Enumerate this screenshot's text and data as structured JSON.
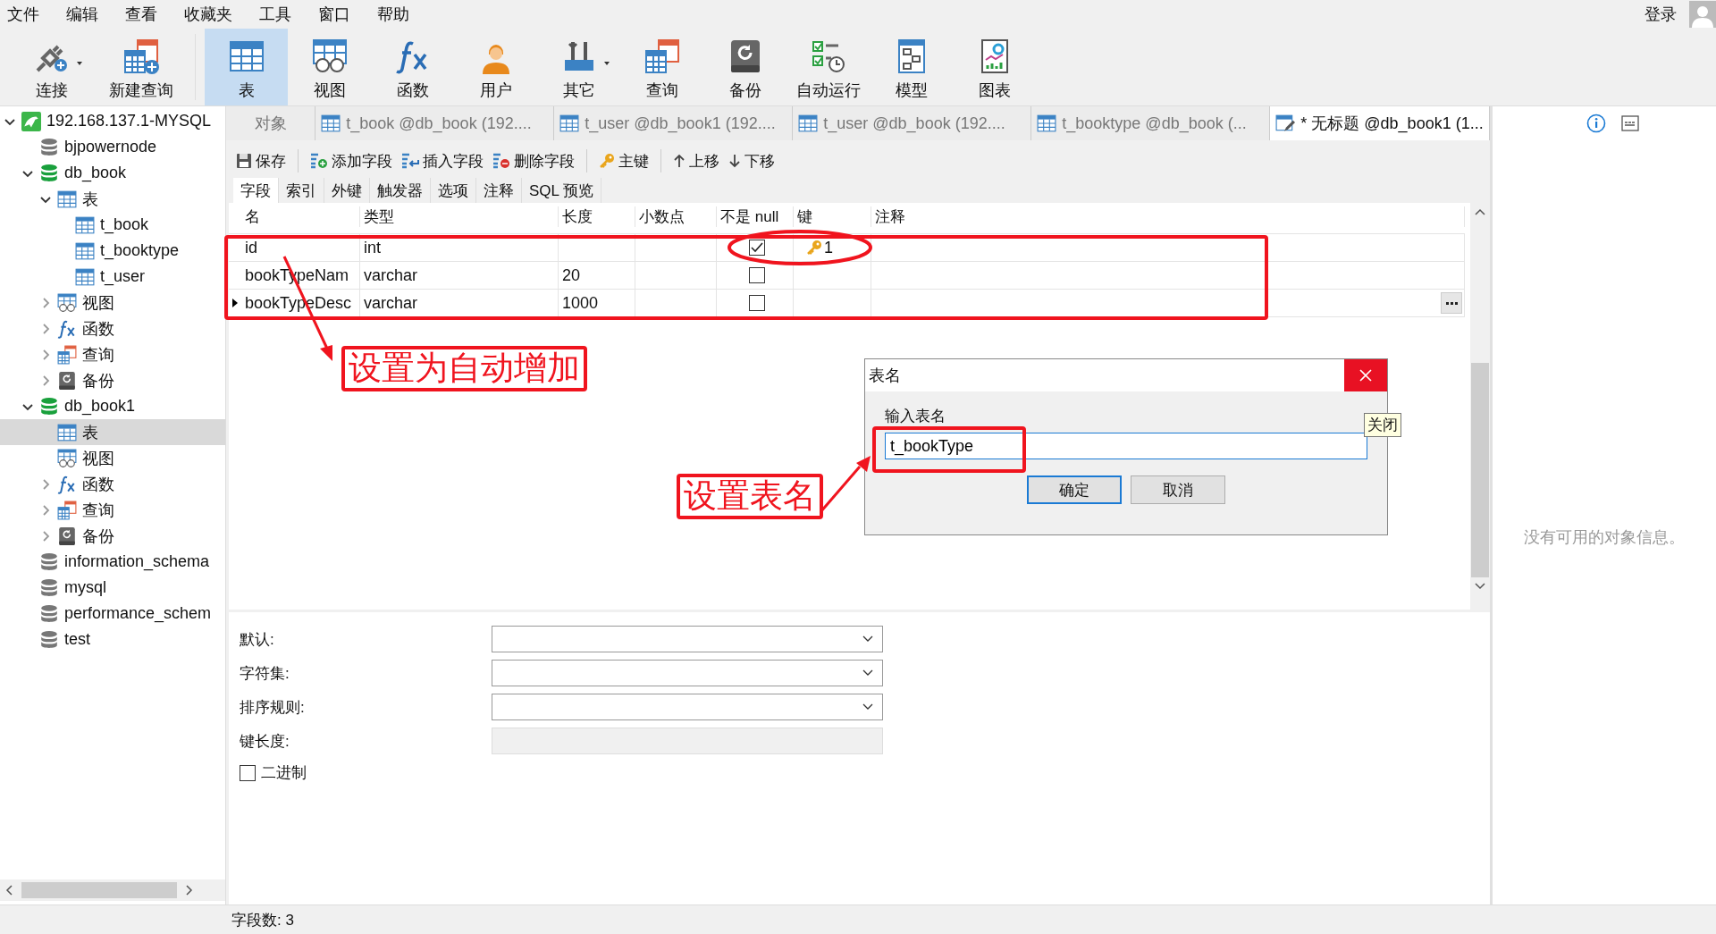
{
  "menu": [
    "文件",
    "编辑",
    "查看",
    "收藏夹",
    "工具",
    "窗口",
    "帮助"
  ],
  "login": "登录",
  "toolbar": [
    {
      "kind": "connect",
      "label": "连接",
      "dropdown": true,
      "selected": false
    },
    {
      "kind": "new-query",
      "label": "新建查询",
      "dropdown": false,
      "selected": false
    },
    {
      "kind": "table",
      "label": "表",
      "dropdown": false,
      "selected": true
    },
    {
      "kind": "view",
      "label": "视图",
      "dropdown": false,
      "selected": false
    },
    {
      "kind": "function",
      "label": "函数",
      "dropdown": false,
      "selected": false
    },
    {
      "kind": "user",
      "label": "用户",
      "dropdown": false,
      "selected": false
    },
    {
      "kind": "tools",
      "label": "其它",
      "dropdown": true,
      "selected": false
    },
    {
      "kind": "query",
      "label": "查询",
      "dropdown": false,
      "selected": false
    },
    {
      "kind": "backup",
      "label": "备份",
      "dropdown": false,
      "selected": false
    },
    {
      "kind": "schedule",
      "label": "自动运行",
      "dropdown": false,
      "selected": false
    },
    {
      "kind": "model",
      "label": "模型",
      "dropdown": false,
      "selected": false
    },
    {
      "kind": "chart",
      "label": "图表",
      "dropdown": false,
      "selected": false
    }
  ],
  "tree": [
    {
      "label": "192.168.137.1-MYSQL",
      "kind": "connection",
      "expanded": true,
      "selected": false,
      "children": [
        {
          "label": "bjpowernode",
          "kind": "database",
          "selected": false
        },
        {
          "label": "db_book",
          "kind": "database-open",
          "expanded": true,
          "selected": false,
          "children": [
            {
              "label": "表",
              "kind": "table",
              "expanded": true,
              "selected": false,
              "children": [
                {
                  "label": "t_book",
                  "kind": "table",
                  "selected": false
                },
                {
                  "label": "t_booktype",
                  "kind": "table",
                  "selected": false
                },
                {
                  "label": "t_user",
                  "kind": "table",
                  "selected": false
                }
              ]
            },
            {
              "label": "视图",
              "kind": "view",
              "expanded": false,
              "selected": false
            },
            {
              "label": "函数",
              "kind": "function",
              "expanded": false,
              "selected": false
            },
            {
              "label": "查询",
              "kind": "query",
              "expanded": false,
              "selected": false
            },
            {
              "label": "备份",
              "kind": "backup",
              "expanded": false,
              "selected": false
            }
          ]
        },
        {
          "label": "db_book1",
          "kind": "database-open",
          "expanded": true,
          "selected": false,
          "children": [
            {
              "label": "表",
              "kind": "table",
              "selected": true
            },
            {
              "label": "视图",
              "kind": "view",
              "selected": false
            },
            {
              "label": "函数",
              "kind": "function",
              "expanded": false,
              "selected": false
            },
            {
              "label": "查询",
              "kind": "query",
              "expanded": false,
              "selected": false
            },
            {
              "label": "备份",
              "kind": "backup",
              "expanded": false,
              "selected": false
            }
          ]
        },
        {
          "label": "information_schema",
          "kind": "database",
          "selected": false
        },
        {
          "label": "mysql",
          "kind": "database",
          "selected": false
        },
        {
          "label": "performance_schem",
          "kind": "database",
          "selected": false
        },
        {
          "label": "test",
          "kind": "database",
          "selected": false
        }
      ]
    }
  ],
  "tabs": [
    {
      "label": "对象",
      "kind": "plain",
      "selected": false
    },
    {
      "label": "t_book @db_book (192....",
      "kind": "table",
      "selected": false
    },
    {
      "label": "t_user @db_book1 (192....",
      "kind": "table",
      "selected": false
    },
    {
      "label": "t_user @db_book (192....",
      "kind": "table",
      "selected": false
    },
    {
      "label": "t_booktype @db_book (...",
      "kind": "table",
      "selected": false
    },
    {
      "label": "* 无标题 @db_book1 (1...",
      "kind": "design",
      "selected": true
    }
  ],
  "design_toolbar": [
    {
      "kind": "save",
      "label": "保存"
    },
    {
      "kind": "add",
      "label": "添加字段"
    },
    {
      "kind": "insert",
      "label": "插入字段"
    },
    {
      "kind": "delete",
      "label": "删除字段"
    },
    {
      "kind": "key",
      "label": "主键"
    },
    {
      "kind": "up",
      "label": "上移"
    },
    {
      "kind": "down",
      "label": "下移"
    }
  ],
  "subtabs": [
    {
      "label": "字段",
      "selected": true
    },
    {
      "label": "索引",
      "selected": false
    },
    {
      "label": "外键",
      "selected": false
    },
    {
      "label": "触发器",
      "selected": false
    },
    {
      "label": "选项",
      "selected": false
    },
    {
      "label": "注释",
      "selected": false
    },
    {
      "label": "SQL 预览",
      "selected": false
    }
  ],
  "fields": {
    "columns": [
      "名",
      "类型",
      "长度",
      "小数点",
      "不是 null",
      "键",
      "注释"
    ],
    "rows": [
      {
        "name": "id",
        "type": "int",
        "not_null": true,
        "key": "1",
        "current": false
      },
      {
        "name": "bookTypeNam",
        "type": "varchar",
        "length": "20",
        "not_null": false,
        "current": false
      },
      {
        "name": "bookTypeDesc",
        "type": "varchar",
        "length": "1000",
        "not_null": false,
        "current": true
      }
    ]
  },
  "properties": [
    {
      "label": "默认:",
      "kind": "dropdown"
    },
    {
      "label": "字符集:",
      "kind": "dropdown"
    },
    {
      "label": "排序规则:",
      "kind": "dropdown"
    },
    {
      "label": "键长度:",
      "kind": "disabled"
    }
  ],
  "binary": {
    "label": "二进制",
    "checked": false
  },
  "status_bar": "字段数: 3",
  "info_panel": "没有可用的对象信息。",
  "dialog": {
    "title": "表名",
    "label": "输入表名",
    "value": "t_bookType",
    "buttons": [
      {
        "label": "确定",
        "default": true
      },
      {
        "label": "取消",
        "default": false
      }
    ],
    "tooltip": "关闭"
  },
  "annotations": [
    {
      "kind": "fields",
      "text": "设置为自动增加"
    },
    {
      "kind": "name",
      "text": "设置表名"
    }
  ]
}
